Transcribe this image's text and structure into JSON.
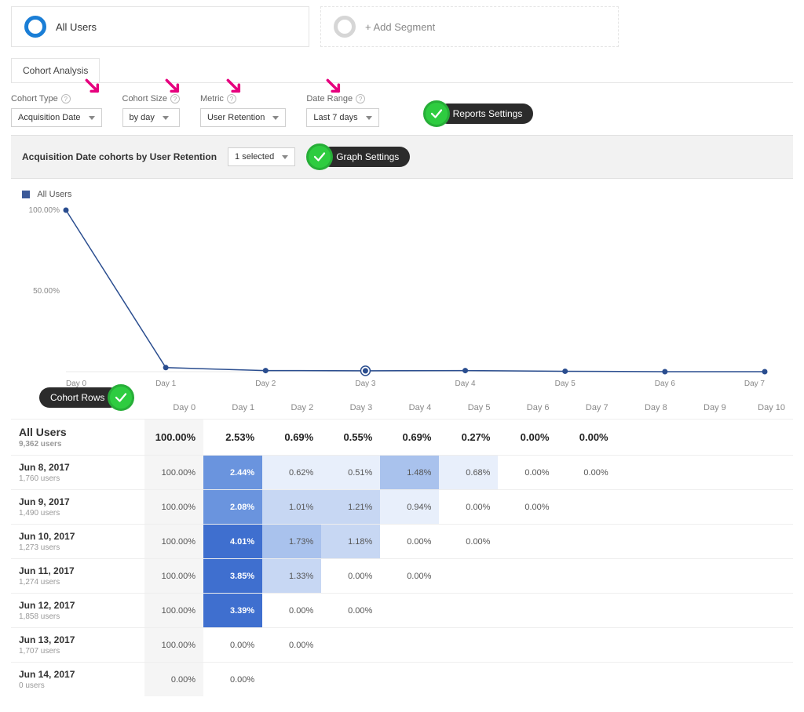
{
  "segments": {
    "primary": "All Users",
    "add": "+ Add Segment"
  },
  "tab": "Cohort Analysis",
  "controls": {
    "cohort_type": {
      "label": "Cohort Type",
      "value": "Acquisition Date"
    },
    "cohort_size": {
      "label": "Cohort Size",
      "value": "by day"
    },
    "metric": {
      "label": "Metric",
      "value": "User Retention"
    },
    "date_range": {
      "label": "Date Range",
      "value": "Last 7 days"
    }
  },
  "badges": {
    "reports": "Reports Settings",
    "graph": "Graph Settings",
    "cohort_rows": "Cohort Rows"
  },
  "graph_header": {
    "subtitle": "Acquisition Date cohorts by User Retention",
    "selected": "1 selected"
  },
  "chart_legend": "All Users",
  "chart_data": {
    "type": "line",
    "title": "",
    "xlabel": "",
    "ylabel": "",
    "ylim": [
      0,
      100
    ],
    "y_ticks": [
      "100.00%",
      "50.00%"
    ],
    "categories": [
      "Day 0",
      "Day 1",
      "Day 2",
      "Day 3",
      "Day 4",
      "Day 5",
      "Day 6",
      "Day 7"
    ],
    "series": [
      {
        "name": "All Users",
        "values": [
          100.0,
          2.53,
          0.69,
          0.55,
          0.69,
          0.27,
          0.0,
          0.0
        ]
      }
    ]
  },
  "table": {
    "headers": [
      "Day 0",
      "Day 1",
      "Day 2",
      "Day 3",
      "Day 4",
      "Day 5",
      "Day 6",
      "Day 7",
      "Day 8",
      "Day 9",
      "Day 10"
    ],
    "summary": {
      "label": "All Users",
      "users": "9,362 users",
      "values": [
        "100.00%",
        "2.53%",
        "0.69%",
        "0.55%",
        "0.69%",
        "0.27%",
        "0.00%",
        "0.00%",
        "",
        "",
        ""
      ]
    },
    "rows": [
      {
        "label": "Jun 8, 2017",
        "users": "1,760 users",
        "values": [
          "100.00%",
          "2.44%",
          "0.62%",
          "0.51%",
          "1.48%",
          "0.68%",
          "0.00%",
          "0.00%",
          "",
          "",
          ""
        ],
        "shades": [
          0,
          5,
          1,
          1,
          3,
          1,
          0,
          0,
          0,
          0,
          0
        ]
      },
      {
        "label": "Jun 9, 2017",
        "users": "1,490 users",
        "values": [
          "100.00%",
          "2.08%",
          "1.01%",
          "1.21%",
          "0.94%",
          "0.00%",
          "0.00%",
          "",
          "",
          "",
          ""
        ],
        "shades": [
          0,
          5,
          2,
          2,
          1,
          0,
          0,
          0,
          0,
          0,
          0
        ]
      },
      {
        "label": "Jun 10, 2017",
        "users": "1,273 users",
        "values": [
          "100.00%",
          "4.01%",
          "1.73%",
          "1.18%",
          "0.00%",
          "0.00%",
          "",
          "",
          "",
          "",
          ""
        ],
        "shades": [
          0,
          6,
          3,
          2,
          0,
          0,
          0,
          0,
          0,
          0,
          0
        ]
      },
      {
        "label": "Jun 11, 2017",
        "users": "1,274 users",
        "values": [
          "100.00%",
          "3.85%",
          "1.33%",
          "0.00%",
          "0.00%",
          "",
          "",
          "",
          "",
          "",
          ""
        ],
        "shades": [
          0,
          6,
          2,
          0,
          0,
          0,
          0,
          0,
          0,
          0,
          0
        ]
      },
      {
        "label": "Jun 12, 2017",
        "users": "1,858 users",
        "values": [
          "100.00%",
          "3.39%",
          "0.00%",
          "0.00%",
          "",
          "",
          "",
          "",
          "",
          "",
          ""
        ],
        "shades": [
          0,
          6,
          0,
          0,
          0,
          0,
          0,
          0,
          0,
          0,
          0
        ]
      },
      {
        "label": "Jun 13, 2017",
        "users": "1,707 users",
        "values": [
          "100.00%",
          "0.00%",
          "0.00%",
          "",
          "",
          "",
          "",
          "",
          "",
          "",
          ""
        ],
        "shades": [
          0,
          0,
          0,
          0,
          0,
          0,
          0,
          0,
          0,
          0,
          0
        ]
      },
      {
        "label": "Jun 14, 2017",
        "users": "0 users",
        "values": [
          "0.00%",
          "0.00%",
          "",
          "",
          "",
          "",
          "",
          "",
          "",
          "",
          ""
        ],
        "shades": [
          0,
          0,
          0,
          0,
          0,
          0,
          0,
          0,
          0,
          0,
          0
        ]
      }
    ]
  },
  "shade_colors": [
    "#ffffff",
    "#e8effb",
    "#c7d7f3",
    "#a9c2ed",
    "#8aace6",
    "#6a94de",
    "#3f6fcf"
  ]
}
